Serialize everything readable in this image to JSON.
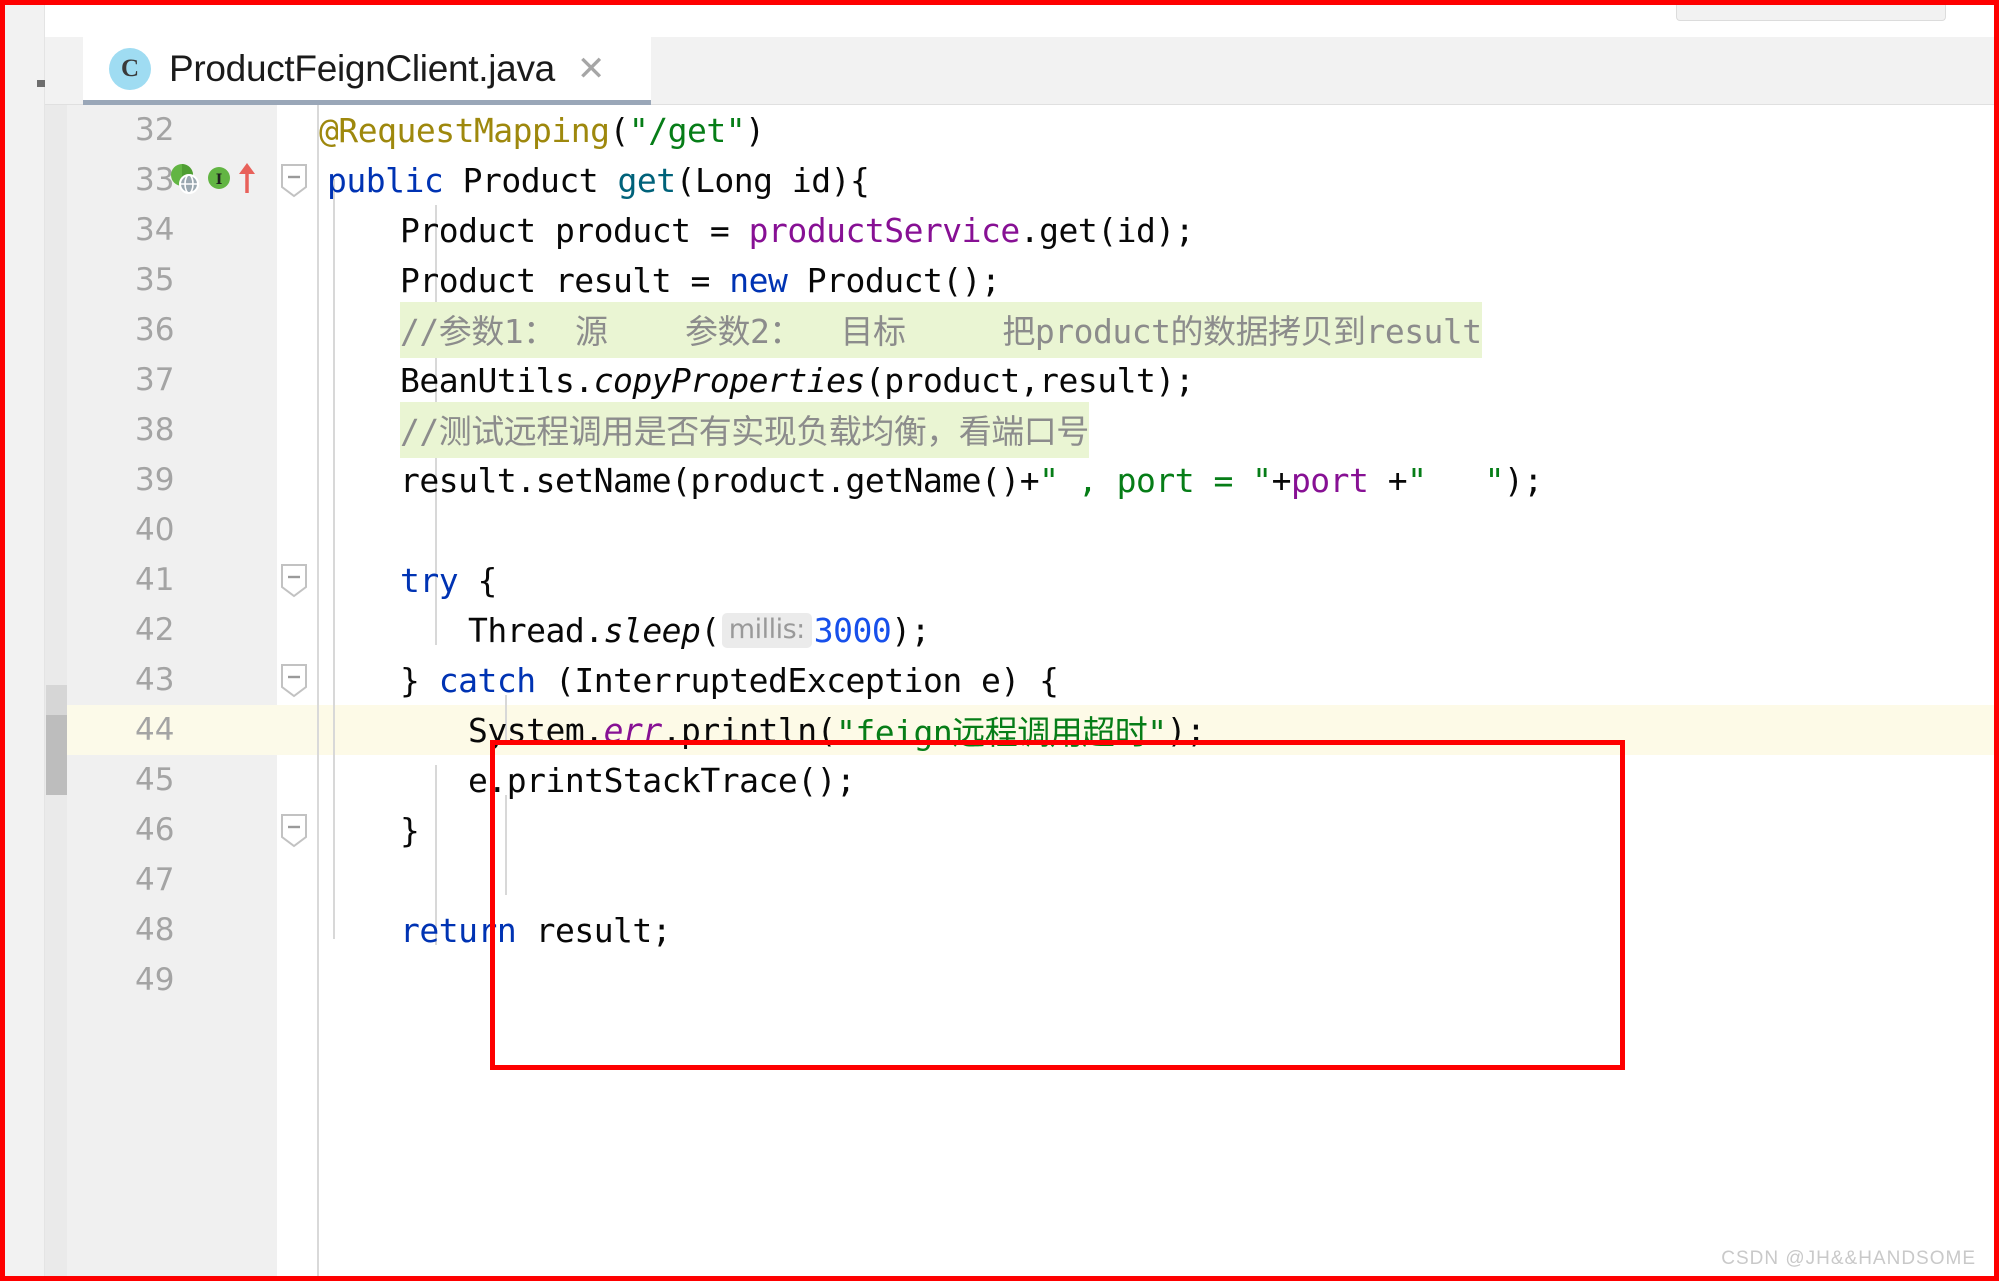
{
  "window": {
    "tab": {
      "icon": "java-class-icon",
      "icon_letter": "C",
      "filename": "ProductFeignClient.java",
      "close_glyph": "✕"
    }
  },
  "editor": {
    "gutter": {
      "line_numbers": [
        "32",
        "33",
        "34",
        "35",
        "36",
        "37",
        "38",
        "39",
        "40",
        "41",
        "42",
        "43",
        "44",
        "45",
        "46",
        "47",
        "48",
        "49"
      ],
      "icons": {
        "line33_web_icon": "web-mapping-icon",
        "line33_impl_icon": "implementing-method-icon",
        "line33_arrow_icon": "arrow-up-icon"
      },
      "fold_markers": [
        "line33-fold-collapse",
        "line41-fold-collapse",
        "line43-fold-collapse",
        "line46-fold-collapse"
      ]
    },
    "caret_line": "44",
    "lines": [
      {
        "num": "32",
        "text": "@RequestMapping(\"/get\")"
      },
      {
        "num": "33",
        "text": "public Product get(Long id){"
      },
      {
        "num": "34",
        "text": "Product product = productService.get(id);"
      },
      {
        "num": "35",
        "text": "Product result = new Product();"
      },
      {
        "num": "36",
        "text": "//参数1： 源    参数2：  目标     把product的数据拷贝到result"
      },
      {
        "num": "37",
        "text": "BeanUtils.copyProperties(product,result);"
      },
      {
        "num": "38",
        "text": "//测试远程调用是否有实现负载均衡，看端口号"
      },
      {
        "num": "39",
        "text": "result.setName(product.getName()+\" , port = \"+port +\"   \");"
      },
      {
        "num": "40",
        "text": ""
      },
      {
        "num": "41",
        "text": "try {"
      },
      {
        "num": "42",
        "text": "Thread.sleep( millis: 3000);"
      },
      {
        "num": "43",
        "text": "} catch (InterruptedException e) {"
      },
      {
        "num": "44",
        "text": "System.err.println(\"feign远程调用超时\");"
      },
      {
        "num": "45",
        "text": "e.printStackTrace();"
      },
      {
        "num": "46",
        "text": "}"
      },
      {
        "num": "47",
        "text": ""
      },
      {
        "num": "48",
        "text": "return result;"
      },
      {
        "num": "49",
        "text": ""
      }
    ],
    "tokens": {
      "l32_anno": "@RequestMapping",
      "l32_paren_open": "(",
      "l32_str": "\"/get\"",
      "l32_paren_close": ")",
      "l33_public": "public",
      "l33_type": " Product ",
      "l33_method": "get",
      "l33_rest": "(Long id){",
      "l34_type": "Product product = ",
      "l34_field": "productService",
      "l34_rest": ".get(id);",
      "l35_a": "Product result = ",
      "l35_new": "new",
      "l35_b": " Product();",
      "l36_comment": "//参数1： 源    参数2：  目标     把product的数据拷贝到result",
      "l37_a": "BeanUtils.",
      "l37_m": "copyProperties",
      "l37_b": "(product,result);",
      "l38_comment": "//测试远程调用是否有实现负载均衡，看端口号",
      "l39_a": "result.setName(product.getName()+",
      "l39_s1": "\" , port = \"",
      "l39_plus1": "+",
      "l39_port": "port ",
      "l39_plus2": "+",
      "l39_s2": "\"   \"",
      "l39_end": ");",
      "l41_try": "try",
      "l41_brace": " {",
      "l42_a": "Thread.",
      "l42_m": "sleep",
      "l42_paren": "(",
      "l42_hint": "millis:",
      "l42_num": "3000",
      "l42_end": ");",
      "l43_a": "} ",
      "l43_catch": "catch",
      "l43_b": " (InterruptedException e) {",
      "l44_a": "System.",
      "l44_err": "err",
      "l44_b": ".println(",
      "l44_str": "\"feign远程调用超时\"",
      "l44_end": ");",
      "l45": "e.printStackTrace();",
      "l46": "}",
      "l48_return": "return",
      "l48_rest": " result;"
    }
  },
  "annotation": {
    "red_box_label": "try-catch-highlight-box"
  },
  "watermark": {
    "text": "CSDN @JH&&HANDSOME"
  },
  "colors": {
    "annotation_red": "#fe0000",
    "annotation_string": "#067d17",
    "keyword_blue": "#0033b3",
    "field_purple": "#871094",
    "method_teal": "#00627a",
    "number_blue": "#1750eb",
    "comment_gray": "#8c8c8c",
    "comment_highlight": "#eaf5d3",
    "caret_line": "#fdfae7",
    "tab_accent": "#9aa7b8"
  }
}
